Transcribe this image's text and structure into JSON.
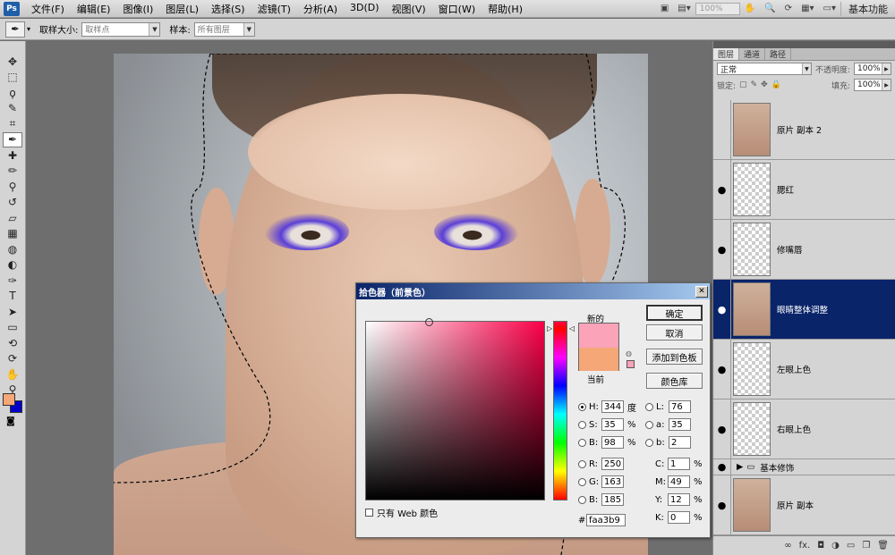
{
  "app": {
    "logo": "Ps"
  },
  "menu": [
    "文件(F)",
    "编辑(E)",
    "图像(I)",
    "图层(L)",
    "选择(S)",
    "滤镜(T)",
    "分析(A)",
    "3D(D)",
    "视图(V)",
    "窗口(W)",
    "帮助(H)"
  ],
  "menubar_right": {
    "zoom": "100%",
    "workspace": "基本功能"
  },
  "options": {
    "sample_size_label": "取样大小:",
    "sample_size_value": "取样点",
    "sample_label": "样本:",
    "sample_value": "所有图层"
  },
  "tools": [
    "move-icon",
    "marquee-icon",
    "lasso-icon",
    "quick-select-icon",
    "crop-icon",
    "eyedropper-icon",
    "healing-icon",
    "brush-icon",
    "clone-stamp-icon",
    "history-brush-icon",
    "eraser-icon",
    "gradient-icon",
    "blur-icon",
    "dodge-icon",
    "pen-icon",
    "type-icon",
    "path-select-icon",
    "shape-icon",
    "3d-rotate-icon",
    "3d-orbit-icon",
    "hand-icon",
    "zoom-icon"
  ],
  "colors": {
    "foreground": "#f5a778",
    "background": "#0000c8",
    "new_color": "#faa3b9",
    "current_color": "#f5a778",
    "selected_layer": "#0a246a"
  },
  "panel": {
    "tabs": [
      "图层",
      "通道",
      "路径"
    ],
    "blend_mode": "正常",
    "opacity_label": "不透明度:",
    "opacity": "100%",
    "lock_label": "锁定:",
    "fill_label": "填充:",
    "fill": "100%",
    "layers": [
      {
        "name": "原片 副本 2",
        "visible": false,
        "thumb": "photo"
      },
      {
        "name": "腮红",
        "visible": true,
        "thumb": "transparent"
      },
      {
        "name": "修嘴唇",
        "visible": true,
        "thumb": "transparent"
      },
      {
        "name": "眼睛整体调整",
        "visible": true,
        "thumb": "photo",
        "selected": true
      },
      {
        "name": "左眼上色",
        "visible": true,
        "thumb": "transparent"
      },
      {
        "name": "右眼上色",
        "visible": true,
        "thumb": "transparent"
      }
    ],
    "group": {
      "name": "基本修饰"
    },
    "bottom_layer": {
      "name": "原片 副本"
    }
  },
  "dialog": {
    "title": "拾色器（前景色）",
    "new_label": "新的",
    "current_label": "当前",
    "buttons": {
      "ok": "确定",
      "cancel": "取消",
      "add_swatch": "添加到色板",
      "libraries": "颜色库"
    },
    "hsb": {
      "H": "344",
      "H_unit": "度",
      "S": "35",
      "S_unit": "%",
      "B": "98",
      "B_unit": "%"
    },
    "lab": {
      "L": "76",
      "a": "35",
      "b": "2"
    },
    "rgb": {
      "R": "250",
      "G": "163",
      "B": "185"
    },
    "cmyk": {
      "C": "1",
      "M": "49",
      "Y": "12",
      "K": "0",
      "unit": "%"
    },
    "hex_label": "#",
    "hex": "faa3b9",
    "web_only": "只有 Web 颜色"
  }
}
